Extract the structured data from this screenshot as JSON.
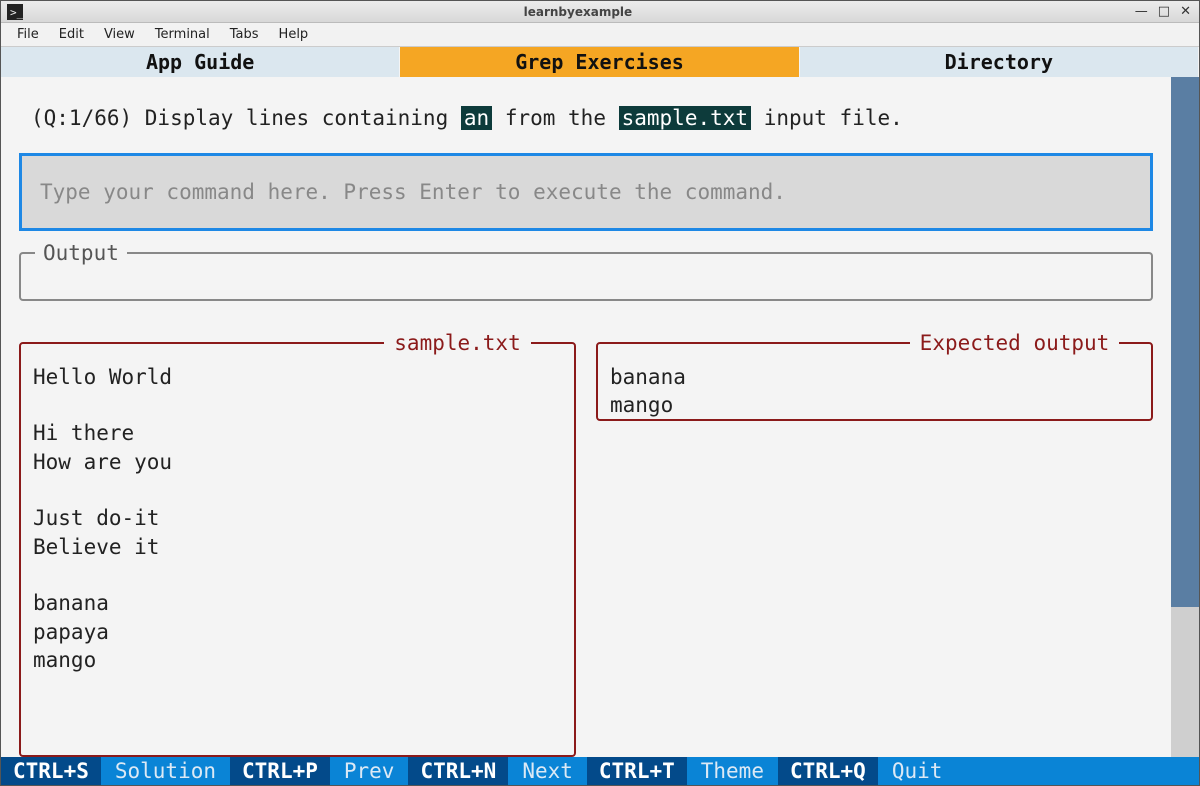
{
  "window": {
    "title": "learnbyexample"
  },
  "menubar": [
    "File",
    "Edit",
    "View",
    "Terminal",
    "Tabs",
    "Help"
  ],
  "tabs": [
    {
      "label": "App Guide",
      "active": false
    },
    {
      "label": "Grep Exercises",
      "active": true
    },
    {
      "label": "Directory",
      "active": false
    }
  ],
  "question": {
    "prefix": "(Q:1/66) Display lines containing ",
    "hl1": "an",
    "mid": " from the ",
    "hl2": "sample.txt",
    "suffix": " input file."
  },
  "input": {
    "placeholder": "Type your command here. Press Enter to execute the command."
  },
  "output": {
    "legend": "Output",
    "text": ""
  },
  "sample": {
    "legend": "sample.txt",
    "text": "Hello World\n\nHi there\nHow are you\n\nJust do-it\nBelieve it\n\nbanana\npapaya\nmango"
  },
  "expected": {
    "legend": "Expected output",
    "text": "banana\nmango"
  },
  "footer": [
    {
      "key": "CTRL+S",
      "label": "Solution"
    },
    {
      "key": "CTRL+P",
      "label": "Prev"
    },
    {
      "key": "CTRL+N",
      "label": "Next"
    },
    {
      "key": "CTRL+T",
      "label": "Theme"
    },
    {
      "key": "CTRL+Q",
      "label": "Quit"
    }
  ]
}
